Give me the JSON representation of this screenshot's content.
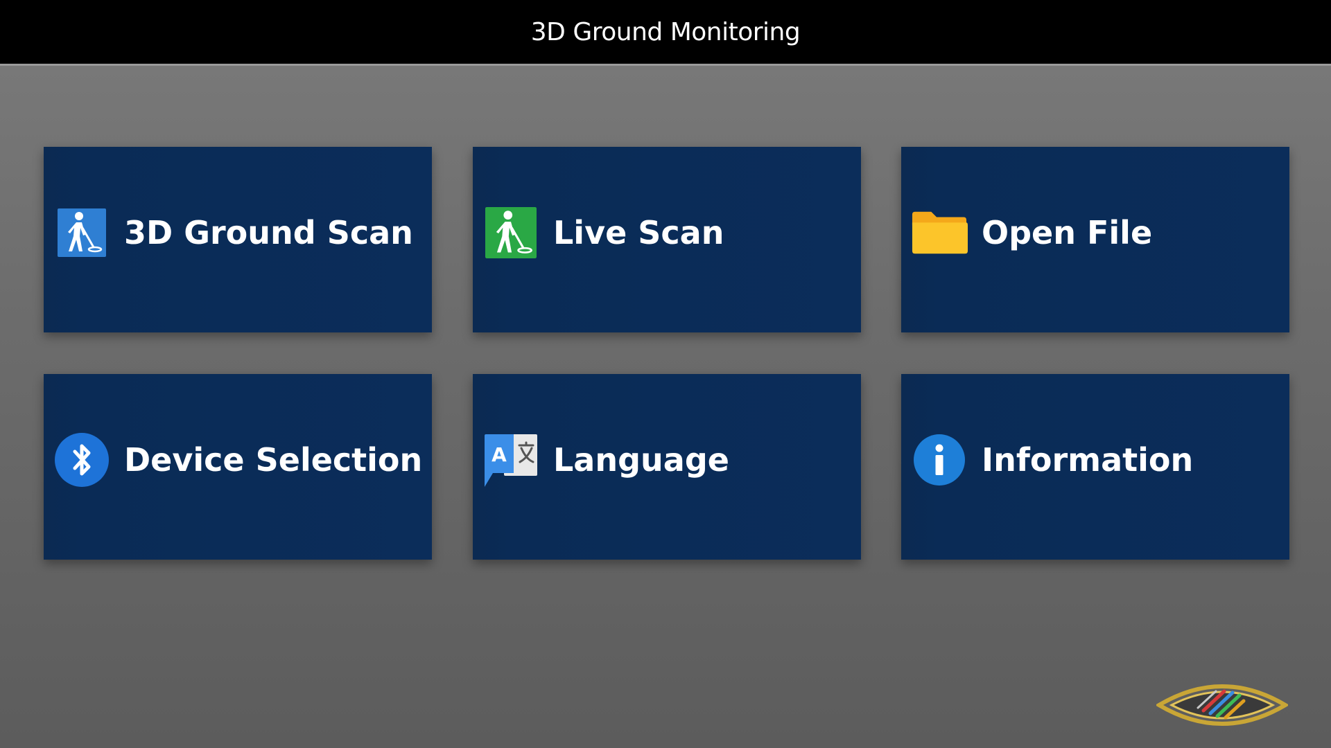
{
  "app": {
    "title": "3D Ground Monitoring"
  },
  "menu": {
    "tiles": [
      {
        "label": "3D Ground Scan",
        "icon": "person-scanning-icon",
        "icon_color": "#2f7fd3"
      },
      {
        "label": "Live Scan",
        "icon": "person-scanning-icon",
        "icon_color": "#2aa845"
      },
      {
        "label": "Open File",
        "icon": "folder-icon",
        "icon_color": "#fbbd1e"
      },
      {
        "label": "Device Selection",
        "icon": "bluetooth-icon",
        "icon_color": "#1e73d8"
      },
      {
        "label": "Language",
        "icon": "translate-icon",
        "icon_color": "#3b8ee8"
      },
      {
        "label": "Information",
        "icon": "info-icon",
        "icon_color": "#1e7fd8"
      }
    ]
  },
  "colors": {
    "title_bar": "#000000",
    "tile_background": "#0b2d5a",
    "page_background": "#6d6d6d"
  }
}
